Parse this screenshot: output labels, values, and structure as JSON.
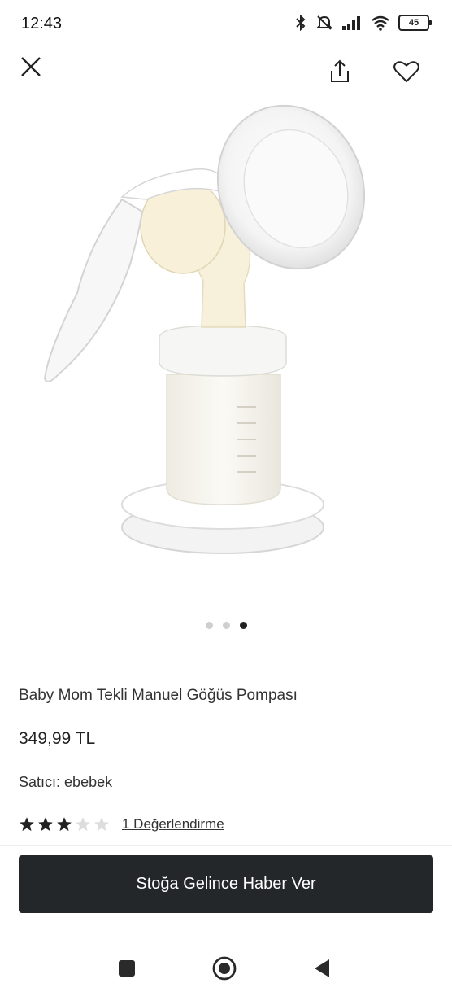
{
  "status_bar": {
    "time": "12:43",
    "battery": "45",
    "icons": [
      "bluetooth-icon",
      "mute-icon",
      "signal-icon",
      "wifi-icon",
      "battery-icon"
    ]
  },
  "top_bar": {
    "icons": [
      "close-icon",
      "share-icon",
      "heart-icon"
    ]
  },
  "gallery": {
    "image_count": 3,
    "active_index": 2
  },
  "product": {
    "title": "Baby Mom Tekli Manuel Göğüs Pompası",
    "price": "349,99 TL",
    "seller_label": "Satıcı:",
    "seller_name": "ebebek",
    "rating": 3,
    "rating_max": 5,
    "reviews_link": "1 Değerlendirme"
  },
  "cta": {
    "label": "Stoğa Gelince Haber Ver"
  },
  "colors": {
    "cta_background": "#24272a",
    "star_filled": "#222222",
    "star_empty": "#dddddd",
    "dot_active": "#222222",
    "dot_inactive": "#cfcfcf"
  },
  "nav_bar": {
    "icons": [
      "recents-square-icon",
      "home-circle-icon",
      "back-triangle-icon"
    ]
  }
}
